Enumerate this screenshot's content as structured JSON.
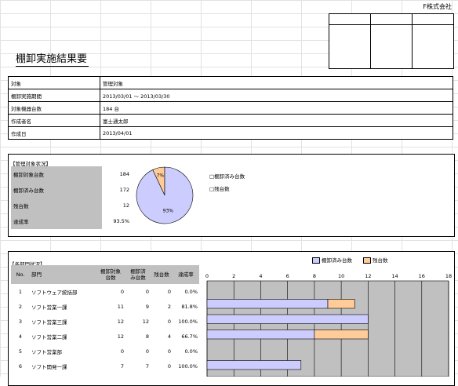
{
  "header": {
    "company": "F株式会社",
    "title": "棚卸実施結果要"
  },
  "info": [
    {
      "k": "対象",
      "v": "管理対象"
    },
    {
      "k": "棚卸実施期間",
      "v": "2013/03/01 ～ 2013/03/30"
    },
    {
      "k": "対象機器台数",
      "v": "184 台"
    },
    {
      "k": "作成者名",
      "v": "富士通太郎"
    },
    {
      "k": "作成日",
      "v": "2013/04/01"
    }
  ],
  "management": {
    "label": "【管理対象状況】",
    "rows": [
      {
        "k": "棚卸対象台数",
        "v": "184"
      },
      {
        "k": "棚卸済み台数",
        "v": "172"
      },
      {
        "k": "残台数",
        "v": "12"
      },
      {
        "k": "達成率",
        "v": "93.5%"
      }
    ],
    "legend": [
      "□棚卸済み台数",
      "□残台数"
    ],
    "colors": {
      "done": "#ccccff",
      "remain": "#ffcc99"
    }
  },
  "chart_data": [
    {
      "type": "pie",
      "labels": [
        "棚卸済み台数",
        "残台数"
      ],
      "values": [
        93,
        7
      ],
      "data_labels": [
        "93%",
        "7%"
      ]
    },
    {
      "type": "bar",
      "stacked": true,
      "orientation": "horizontal",
      "categories": [
        "ソフトウェア統括部",
        "ソフト営業一課",
        "ソフト営業三課",
        "ソフト営業二課",
        "ソフト営業部",
        "ソフト開発一課"
      ],
      "series": [
        {
          "name": "棚卸済み台数",
          "values": [
            0,
            9,
            12,
            8,
            0,
            7
          ]
        },
        {
          "name": "残台数",
          "values": [
            0,
            2,
            0,
            4,
            0,
            0
          ]
        }
      ],
      "xlim": [
        0,
        18
      ],
      "xticks": [
        "0",
        "2",
        "4",
        "6",
        "8",
        "10",
        "12",
        "14",
        "16",
        "18"
      ],
      "grid": true
    }
  ],
  "dept": {
    "label": "【各部門状況】",
    "headers": [
      "No.",
      "部門",
      "棚卸対象\n台数",
      "棚卸済\nみ台数",
      "残台数",
      "達成率"
    ],
    "rows": [
      {
        "no": "1",
        "name": "ソフトウェア統括部",
        "target": "0",
        "done": "0",
        "remain": "0",
        "rate": "0.0%"
      },
      {
        "no": "2",
        "name": "ソフト営業一課",
        "target": "11",
        "done": "9",
        "remain": "2",
        "rate": "81.8%"
      },
      {
        "no": "3",
        "name": "ソフト営業三課",
        "target": "12",
        "done": "12",
        "remain": "0",
        "rate": "100.0%"
      },
      {
        "no": "4",
        "name": "ソフト営業二課",
        "target": "12",
        "done": "8",
        "remain": "4",
        "rate": "66.7%"
      },
      {
        "no": "5",
        "name": "ソフト営業部",
        "target": "0",
        "done": "0",
        "remain": "0",
        "rate": "0.0%"
      },
      {
        "no": "6",
        "name": "ソフト開発一課",
        "target": "7",
        "done": "7",
        "remain": "0",
        "rate": "100.0%"
      }
    ]
  }
}
